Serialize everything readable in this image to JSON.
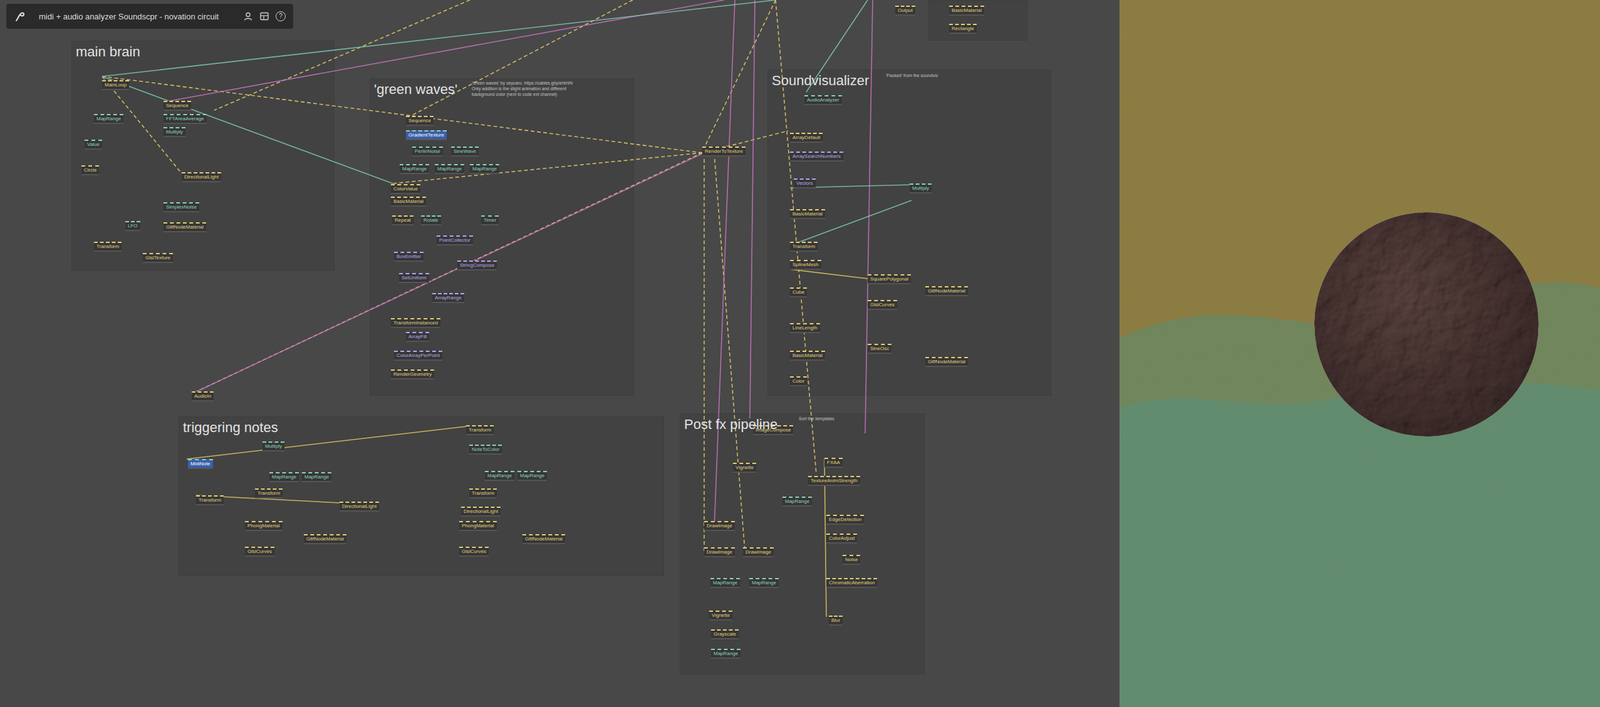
{
  "window": {
    "title": "midi + audio analyzer Soundscpr - novation circuit",
    "help": "?"
  },
  "groups": [
    {
      "title": "main brain"
    },
    {
      "title": "'green waves'"
    },
    {
      "title": "Soundvisualizer"
    },
    {
      "title": "triggering notes"
    },
    {
      "title": "Post fx pipeline"
    },
    {
      "title": ""
    }
  ],
  "comments": [
    {
      "lines": [
        "'Green waves' by seycaro. https://cables.gl/p/ehtr9N",
        "Only addition is the slight animation and different",
        "background color (next to code ext channel)"
      ]
    },
    {
      "lines": [
        "'Packed' from the soundviz"
      ]
    },
    {
      "lines": [
        "Sort the templates"
      ]
    }
  ],
  "ops": [
    {
      "name": "MainLoop",
      "kind": "gl"
    },
    {
      "name": "Sequence",
      "kind": "gl"
    },
    {
      "name": "MapRange",
      "kind": "math"
    },
    {
      "name": "FFTAreaAverage",
      "kind": "math"
    },
    {
      "name": "Multiply",
      "kind": "math"
    },
    {
      "name": "Value",
      "kind": "math"
    },
    {
      "name": "Circle",
      "kind": "gl"
    },
    {
      "name": "DirectionalLight",
      "kind": "gl"
    },
    {
      "name": "SimplexNoise",
      "kind": "math"
    },
    {
      "name": "LFO",
      "kind": "math"
    },
    {
      "name": "GltfNodeMaterial",
      "kind": "gl"
    },
    {
      "name": "Transform",
      "kind": "gl"
    },
    {
      "name": "GlslTexture",
      "kind": "gl"
    },
    {
      "name": "Sequence",
      "kind": "gl"
    },
    {
      "name": "GradientTexture",
      "kind": "highlight"
    },
    {
      "name": "PerlinNoise",
      "kind": "math"
    },
    {
      "name": "SineWave",
      "kind": "math"
    },
    {
      "name": "MapRange",
      "kind": "math"
    },
    {
      "name": "MapRange",
      "kind": "math"
    },
    {
      "name": "MapRange",
      "kind": "math"
    },
    {
      "name": "ColorValue",
      "kind": "gl"
    },
    {
      "name": "BasicMaterial",
      "kind": "gl"
    },
    {
      "name": "Repeat",
      "kind": "gl"
    },
    {
      "name": "Rotate",
      "kind": "math"
    },
    {
      "name": "Timer",
      "kind": "math"
    },
    {
      "name": "PointCollector",
      "kind": "array"
    },
    {
      "name": "BoxEmitter",
      "kind": "array"
    },
    {
      "name": "StringCompose",
      "kind": "array"
    },
    {
      "name": "SetUniform",
      "kind": "array"
    },
    {
      "name": "ArrayRange",
      "kind": "array"
    },
    {
      "name": "TransformInstanced",
      "kind": "gl"
    },
    {
      "name": "ArrayFill",
      "kind": "array"
    },
    {
      "name": "ColorArrayPerPoint",
      "kind": "array"
    },
    {
      "name": "RenderGeometry",
      "kind": "gl"
    },
    {
      "name": "AudioAnalyzer",
      "kind": "math"
    },
    {
      "name": "ArrayDefault",
      "kind": "gl"
    },
    {
      "name": "ArraySearchNumbers",
      "kind": "array"
    },
    {
      "name": "Vectors",
      "kind": "array"
    },
    {
      "name": "Multiply",
      "kind": "math"
    },
    {
      "name": "BasicMaterial",
      "kind": "gl"
    },
    {
      "name": "Transform",
      "kind": "gl"
    },
    {
      "name": "SplineMesh",
      "kind": "gl"
    },
    {
      "name": "SquarePolygonal",
      "kind": "gl"
    },
    {
      "name": "GltfNodeMaterial",
      "kind": "gl"
    },
    {
      "name": "Cube",
      "kind": "gl"
    },
    {
      "name": "GlslCurves",
      "kind": "gl"
    },
    {
      "name": "LineLength",
      "kind": "gl"
    },
    {
      "name": "SineOsc",
      "kind": "gl"
    },
    {
      "name": "BasicMaterial",
      "kind": "gl"
    },
    {
      "name": "GltfNodeMaterial",
      "kind": "gl"
    },
    {
      "name": "Color",
      "kind": "gl"
    },
    {
      "name": "MidiNote",
      "kind": "highlight"
    },
    {
      "name": "Transform",
      "kind": "gl"
    },
    {
      "name": "Multiply",
      "kind": "math"
    },
    {
      "name": "MapRange",
      "kind": "math"
    },
    {
      "name": "MapRange",
      "kind": "math"
    },
    {
      "name": "Transform",
      "kind": "gl"
    },
    {
      "name": "Transform",
      "kind": "gl"
    },
    {
      "name": "NoteToColor",
      "kind": "math"
    },
    {
      "name": "MapRange",
      "kind": "math"
    },
    {
      "name": "MapRange",
      "kind": "math"
    },
    {
      "name": "Transform",
      "kind": "gl"
    },
    {
      "name": "DirectionalLight",
      "kind": "gl"
    },
    {
      "name": "DirectionalLight",
      "kind": "gl"
    },
    {
      "name": "PhongMaterial",
      "kind": "gl"
    },
    {
      "name": "PhongMaterial",
      "kind": "gl"
    },
    {
      "name": "GltfNodeMaterial",
      "kind": "gl"
    },
    {
      "name": "GltfNodeMaterial",
      "kind": "gl"
    },
    {
      "name": "GlslCurves",
      "kind": "gl"
    },
    {
      "name": "GlslCurves",
      "kind": "gl"
    },
    {
      "name": "ImageCompose",
      "kind": "gl"
    },
    {
      "name": "Vignette",
      "kind": "gl"
    },
    {
      "name": "FXAA",
      "kind": "gl"
    },
    {
      "name": "TextureAnimStrength",
      "kind": "gl"
    },
    {
      "name": "MapRange",
      "kind": "math"
    },
    {
      "name": "EdgeDetection",
      "kind": "gl"
    },
    {
      "name": "DrawImage",
      "kind": "gl"
    },
    {
      "name": "ColorAdjust",
      "kind": "gl"
    },
    {
      "name": "DrawImage",
      "kind": "gl"
    },
    {
      "name": "DrawImage",
      "kind": "gl"
    },
    {
      "name": "Noise",
      "kind": "gl"
    },
    {
      "name": "MapRange",
      "kind": "math"
    },
    {
      "name": "MapRange",
      "kind": "math"
    },
    {
      "name": "ChromaticAberration",
      "kind": "gl"
    },
    {
      "name": "Vignette",
      "kind": "gl"
    },
    {
      "name": "Blur",
      "kind": "gl"
    },
    {
      "name": "Grayscale",
      "kind": "gl"
    },
    {
      "name": "MapRange",
      "kind": "math"
    },
    {
      "name": "RenderToTexture",
      "kind": "gl"
    },
    {
      "name": "AudioIn",
      "kind": "gl"
    },
    {
      "name": "Output",
      "kind": "gl"
    },
    {
      "name": "BasicMaterial",
      "kind": "gl"
    },
    {
      "name": "Rectangle",
      "kind": "gl"
    }
  ]
}
